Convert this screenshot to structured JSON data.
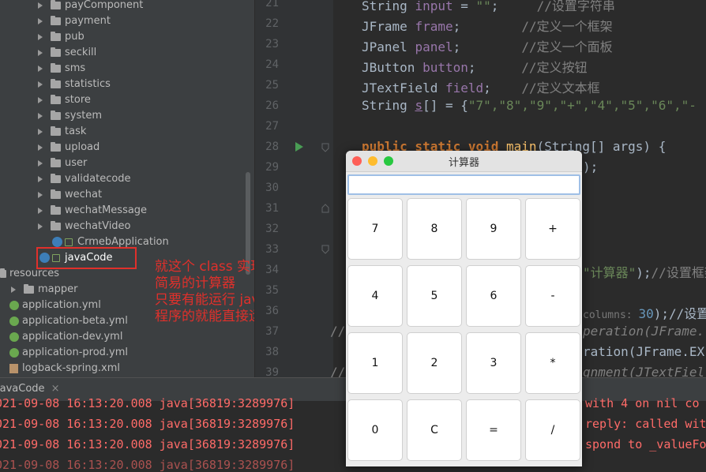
{
  "tree": {
    "items": [
      {
        "label": "payComponent"
      },
      {
        "label": "payment"
      },
      {
        "label": "pub"
      },
      {
        "label": "seckill"
      },
      {
        "label": "sms"
      },
      {
        "label": "statistics"
      },
      {
        "label": "store"
      },
      {
        "label": "system"
      },
      {
        "label": "task"
      },
      {
        "label": "upload"
      },
      {
        "label": "user"
      },
      {
        "label": "validatecode"
      },
      {
        "label": "wechat"
      },
      {
        "label": "wechatMessage"
      },
      {
        "label": "wechatVideo"
      },
      {
        "label": "CrmebApplication"
      },
      {
        "label": "javaCode"
      },
      {
        "label": "resources"
      },
      {
        "label": "mapper"
      },
      {
        "label": "application.yml"
      },
      {
        "label": "application-beta.yml"
      },
      {
        "label": "application-dev.yml"
      },
      {
        "label": "application-prod.yml"
      },
      {
        "label": "logback-spring.xml"
      }
    ]
  },
  "annotation": {
    "text": "就这个 class 实现了\n简易的计算器\n只要有能运行 java\n程序的就能直接运行"
  },
  "gutter": {
    "lines": [
      "21",
      "22",
      "23",
      "24",
      "25",
      "26",
      "27",
      "28",
      "29",
      "30",
      "31",
      "32",
      "33",
      "34",
      "35",
      "36",
      "37",
      "38",
      "39"
    ]
  },
  "code": {
    "l21a": "String ",
    "l21b": "input",
    " l21c": " = ",
    "l21d": "\"\"",
    "l21e": ";     ",
    "l21f": "//设置字符串",
    "l22a": "JFrame ",
    "l22b": "frame",
    "l22c": ";        ",
    "l22d": "//定义一个框架",
    "l23a": "JPanel ",
    "l23b": "panel",
    "l23c": ";        ",
    "l23d": "//定义一个面板",
    "l24a": "JButton ",
    "l24b": "button",
    "l24c": ";      ",
    "l24d": "//定义按钮",
    "l25a": "JTextField ",
    "l25b": "field",
    "l25c": ";    ",
    "l25d": "//定义文本框",
    "l26a": "String ",
    "l26b": "s",
    "l26c": "[] = {",
    "l26d": "\"7\",\"8\",\"9\",\"+\",\"4\",\"5\",\"6\",\"-",
    "l28a": "public static void ",
    "l28b": "main",
    "l28c": "(String[] args) {",
    "l29": ");",
    "l34a": "\"计算器\"",
    "l34b": ");",
    "l34c": "//设置框架",
    "l36a": "columns: ",
    "l36b": "30",
    "l36c": ");//设置",
    "l37a": "//",
    "l37b": "peration(JFrame.",
    "l38": "ration(JFrame.EX",
    "l39a": "//",
    "l39b": "gnment(JTextFiel"
  },
  "console": {
    "tab": "javaCode",
    "lines": [
      "021-09-08 16:13:20.008 java[36819:3289976] ",
      "021-09-08 16:13:20.008 java[36819:3289976] ",
      "021-09-08 16:13:20.008 java[36819:3289976] ",
      "021-09-08 16:13:20.008 java[36819:3289976] "
    ],
    "tails": [
      "with 4 on nil co",
      "reply: called wit",
      "spond to _valueFo",
      ""
    ]
  },
  "calculator": {
    "title": "计算器",
    "display_value": "",
    "keys": [
      "7",
      "8",
      "9",
      "+",
      "4",
      "5",
      "6",
      "-",
      "1",
      "2",
      "3",
      "*",
      "0",
      "C",
      "=",
      "/"
    ],
    "colors": {
      "close": "#fe5f57",
      "minimize": "#febc2e",
      "zoom": "#28c840"
    }
  }
}
